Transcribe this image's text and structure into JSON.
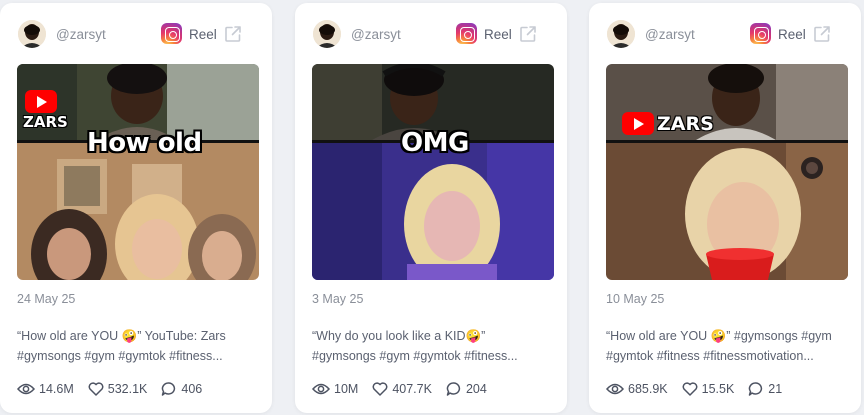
{
  "cards": [
    {
      "username": "@zarsyt",
      "platform_label": "Reel",
      "overlay_text": "How old",
      "badge_text": "ZARS",
      "date": "24 May 25",
      "caption_line1": "“How old are YOU 🤪” YouTube: Zars",
      "caption_line2": "#gymsongs #gym #gymtok #fitness...",
      "views": "14.6M",
      "likes": "532.1K",
      "comments": "406"
    },
    {
      "username": "@zarsyt",
      "platform_label": "Reel",
      "overlay_text": "OMG",
      "badge_text": "",
      "date": "3 May 25",
      "caption_line1": "“Why do you look like a KID🤪”",
      "caption_line2": "#gymsongs #gym #gymtok #fitness...",
      "views": "10M",
      "likes": "407.7K",
      "comments": "204"
    },
    {
      "username": "@zarsyt",
      "platform_label": "Reel",
      "overlay_text": "",
      "badge_text": "ZARS",
      "date": "10 May 25",
      "caption_line1": "“How old are YOU 🤪” #gymsongs #gym",
      "caption_line2": "#gymtok #fitness #fitnessmotivation...",
      "views": "685.9K",
      "likes": "15.5K",
      "comments": "21"
    }
  ],
  "icons": {
    "platform": "instagram-icon",
    "external": "external-link-icon",
    "views": "eye-icon",
    "likes": "heart-icon",
    "comments": "comment-icon",
    "badge": "youtube-icon"
  },
  "colors": {
    "background": "#eef0f4",
    "card": "#ffffff",
    "muted_text": "#8a8f99",
    "body_text": "#5b6170",
    "youtube_red": "#ff0000"
  }
}
